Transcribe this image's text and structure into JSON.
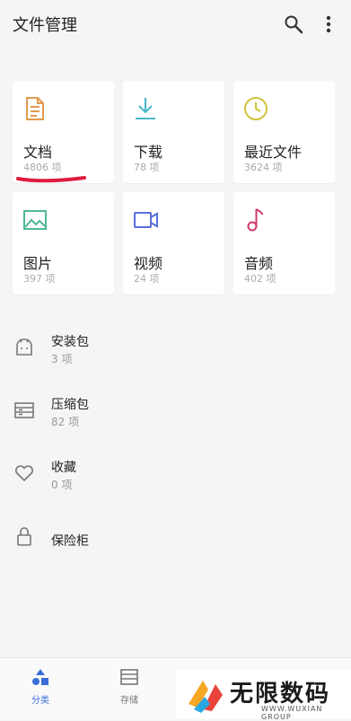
{
  "header": {
    "title": "文件管理"
  },
  "categories": [
    {
      "label": "文档",
      "count": "4806 项",
      "icon": "document-icon",
      "color": "#e29a4f"
    },
    {
      "label": "下载",
      "count": "78 项",
      "icon": "download-icon",
      "color": "#47b6c9"
    },
    {
      "label": "最近文件",
      "count": "3624 项",
      "icon": "clock-icon",
      "color": "#cfc53b"
    },
    {
      "label": "图片",
      "count": "397 项",
      "icon": "image-icon",
      "color": "#4eb891"
    },
    {
      "label": "视频",
      "count": "24 项",
      "icon": "video-icon",
      "color": "#5a6ed8"
    },
    {
      "label": "音频",
      "count": "402 项",
      "icon": "music-note-icon",
      "color": "#d2386a"
    }
  ],
  "list": [
    {
      "title": "安装包",
      "sub": "3 项",
      "icon": "android-icon"
    },
    {
      "title": "压缩包",
      "sub": "82 项",
      "icon": "archive-icon"
    },
    {
      "title": "收藏",
      "sub": "0 项",
      "icon": "heart-icon"
    },
    {
      "title": "保险柜",
      "sub": "",
      "icon": "lock-icon"
    }
  ],
  "bottom_nav": [
    {
      "label": "分类",
      "icon": "category-shapes-icon",
      "active": true
    },
    {
      "label": "存储",
      "icon": "storage-icon",
      "active": false
    }
  ],
  "watermark": {
    "name": "无限数码",
    "tagline": "WWW.WUXIAN GROUP"
  },
  "colors": {
    "accent": "#3a6fd8",
    "annotation": "#e01b3c"
  }
}
